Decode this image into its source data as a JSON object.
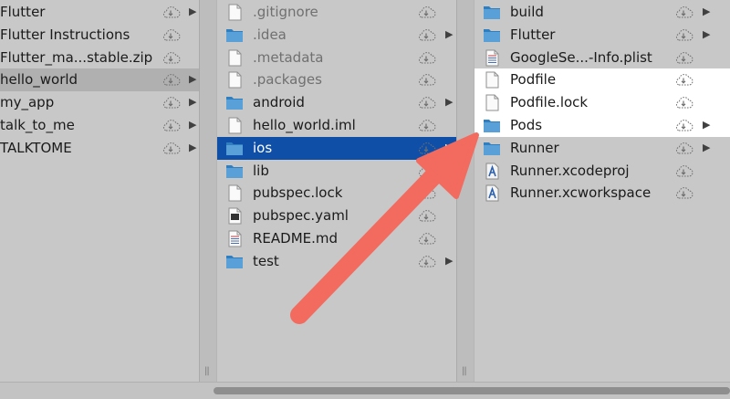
{
  "colors": {
    "selection_blue": "#0f4fa8",
    "arrow": "#f26b5e",
    "folder": "#2f7fc0"
  },
  "columns": [
    {
      "items": [
        {
          "label": "Flutter",
          "icon": "none",
          "chevron": true
        },
        {
          "label": "Flutter Instructions",
          "icon": "none",
          "chevron": false
        },
        {
          "label": "Flutter_ma...stable.zip",
          "icon": "none",
          "chevron": false
        },
        {
          "label": "hello_world",
          "icon": "none",
          "chevron": true,
          "state": "selected-inactive"
        },
        {
          "label": "my_app",
          "icon": "none",
          "chevron": true
        },
        {
          "label": "talk_to_me",
          "icon": "none",
          "chevron": true
        },
        {
          "label": "TALKTOME",
          "icon": "none",
          "chevron": true
        }
      ]
    },
    {
      "items": [
        {
          "label": ".gitignore",
          "icon": "file-icon",
          "chevron": false,
          "dim": true
        },
        {
          "label": ".idea",
          "icon": "folder-icon",
          "chevron": true,
          "dim": true
        },
        {
          "label": ".metadata",
          "icon": "file-icon",
          "chevron": false,
          "dim": true
        },
        {
          "label": ".packages",
          "icon": "file-icon",
          "chevron": false,
          "dim": true
        },
        {
          "label": "android",
          "icon": "folder-icon",
          "chevron": true
        },
        {
          "label": "hello_world.iml",
          "icon": "file-icon",
          "chevron": false
        },
        {
          "label": "ios",
          "icon": "folder-icon",
          "chevron": true,
          "state": "selected"
        },
        {
          "label": "lib",
          "icon": "folder-icon",
          "chevron": true
        },
        {
          "label": "pubspec.lock",
          "icon": "file-icon",
          "chevron": false
        },
        {
          "label": "pubspec.yaml",
          "icon": "yaml-file-icon",
          "chevron": false
        },
        {
          "label": "README.md",
          "icon": "text-file-icon",
          "chevron": false
        },
        {
          "label": "test",
          "icon": "folder-icon",
          "chevron": true
        }
      ]
    },
    {
      "items": [
        {
          "label": "build",
          "icon": "folder-icon",
          "chevron": true
        },
        {
          "label": "Flutter",
          "icon": "folder-icon",
          "chevron": true
        },
        {
          "label": "GoogleSe...-Info.plist",
          "icon": "plist-file-icon",
          "chevron": false
        },
        {
          "label": "Podfile",
          "icon": "file-icon",
          "chevron": false,
          "state": "highlighted"
        },
        {
          "label": "Podfile.lock",
          "icon": "file-icon",
          "chevron": false,
          "state": "highlighted"
        },
        {
          "label": "Pods",
          "icon": "folder-icon",
          "chevron": true,
          "state": "highlighted"
        },
        {
          "label": "Runner",
          "icon": "folder-icon",
          "chevron": true
        },
        {
          "label": "Runner.xcodeproj",
          "icon": "xcodeproj-icon",
          "chevron": false
        },
        {
          "label": "Runner.xcworkspace",
          "icon": "xcworkspace-icon",
          "chevron": false
        }
      ]
    }
  ],
  "icons": {
    "cloud": "icloud-download-icon",
    "chevron": "chevron-right-icon",
    "grip": "column-resize-grip"
  },
  "grip_glyph": "||",
  "chevron_glyph": "▶"
}
